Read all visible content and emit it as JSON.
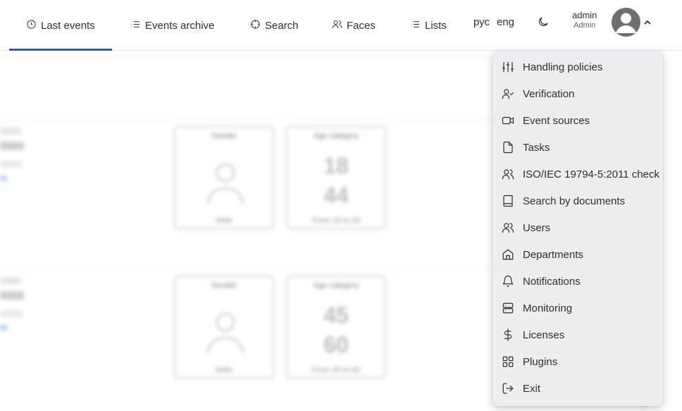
{
  "nav": {
    "tabs": [
      {
        "label": "Last events",
        "icon": "clock-icon",
        "active": true
      },
      {
        "label": "Events archive",
        "icon": "list-icon"
      },
      {
        "label": "Search",
        "icon": "crosshair-icon"
      },
      {
        "label": "Faces",
        "icon": "users-icon"
      },
      {
        "label": "Lists",
        "icon": "list-icon"
      }
    ],
    "lang_ru": "рус",
    "lang_en": "eng",
    "theme_icon": "moon-icon",
    "user": {
      "name": "admin",
      "role": "Admin"
    },
    "accent_color": "#1e63b5"
  },
  "background": {
    "cards": [
      {
        "title": "Gender",
        "footer": "Male"
      },
      {
        "title": "Age category",
        "age_from": "18",
        "age_to": "44",
        "footer": "From 18 to 44"
      },
      {
        "title": "Gender",
        "footer": "Male"
      },
      {
        "title": "Age category",
        "age_from": "45",
        "age_to": "60",
        "footer": "From 45 to 60"
      }
    ]
  },
  "menu": {
    "items": [
      {
        "label": "Handling policies",
        "icon": "sliders-icon"
      },
      {
        "label": "Verification",
        "icon": "user-check-icon"
      },
      {
        "label": "Event sources",
        "icon": "video-icon"
      },
      {
        "label": "Tasks",
        "icon": "file-icon"
      },
      {
        "label": "ISO/IEC 19794-5:2011 check",
        "icon": "users-icon"
      },
      {
        "label": "Search by documents",
        "icon": "book-icon"
      },
      {
        "label": "Users",
        "icon": "users-icon"
      },
      {
        "label": "Departments",
        "icon": "home-icon"
      },
      {
        "label": "Notifications",
        "icon": "bell-icon"
      },
      {
        "label": "Monitoring",
        "icon": "server-icon"
      },
      {
        "label": "Licenses",
        "icon": "dollar-icon"
      },
      {
        "label": "Plugins",
        "icon": "grid-icon"
      },
      {
        "label": "Exit",
        "icon": "log-out-icon"
      }
    ]
  }
}
